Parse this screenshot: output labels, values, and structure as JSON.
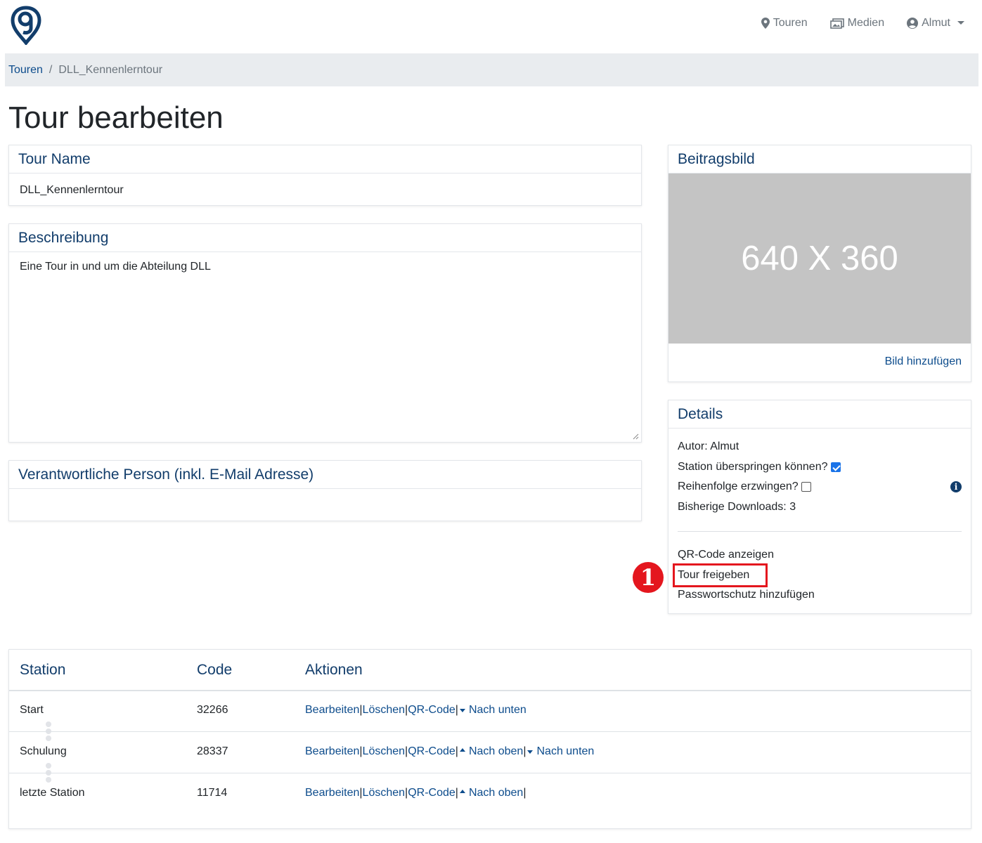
{
  "nav": {
    "items": [
      {
        "label": "Touren",
        "icon": "map-pin-icon"
      },
      {
        "label": "Medien",
        "icon": "images-icon"
      },
      {
        "label": "Almut",
        "icon": "user-circle-icon"
      }
    ]
  },
  "breadcrumb": {
    "root": "Touren",
    "separator": "/",
    "current": "DLL_Kennenlerntour"
  },
  "page_title": "Tour bearbeiten",
  "tour_name": {
    "header": "Tour Name",
    "value": "DLL_Kennenlerntour"
  },
  "description": {
    "header": "Beschreibung",
    "value": "Eine Tour in und um die Abteilung DLL"
  },
  "responsible": {
    "header": "Verantwortliche Person (inkl. E-Mail Adresse)",
    "value": ""
  },
  "image": {
    "header": "Beitragsbild",
    "placeholder": "640 X 360",
    "add_label": "Bild hinzufügen"
  },
  "details": {
    "header": "Details",
    "author": "Autor: Almut",
    "skip_label": "Station überspringen können?",
    "skip_checked": true,
    "order_label": "Reihenfolge erzwingen?",
    "order_checked": false,
    "downloads": "Bisherige Downloads: 3",
    "links": {
      "qr": "QR-Code anzeigen",
      "share": "Tour freigeben",
      "password": "Passwortschutz hinzufügen"
    },
    "annotation_number": "1"
  },
  "table": {
    "headers": {
      "station": "Station",
      "code": "Code",
      "actions": "Aktionen"
    },
    "rows": [
      {
        "station": "Start",
        "code": "32266"
      },
      {
        "station": "Schulung",
        "code": "28337"
      },
      {
        "station": "letzte Station",
        "code": "11714"
      }
    ],
    "actions": {
      "edit": "Bearbeiten",
      "delete": "Löschen",
      "qr": "QR-Code",
      "down": "Nach unten",
      "up": "Nach oben",
      "sep": "|"
    }
  },
  "colors": {
    "accent": "#0d4c8c",
    "header_text": "#123d6b",
    "highlight": "#e4161e"
  }
}
